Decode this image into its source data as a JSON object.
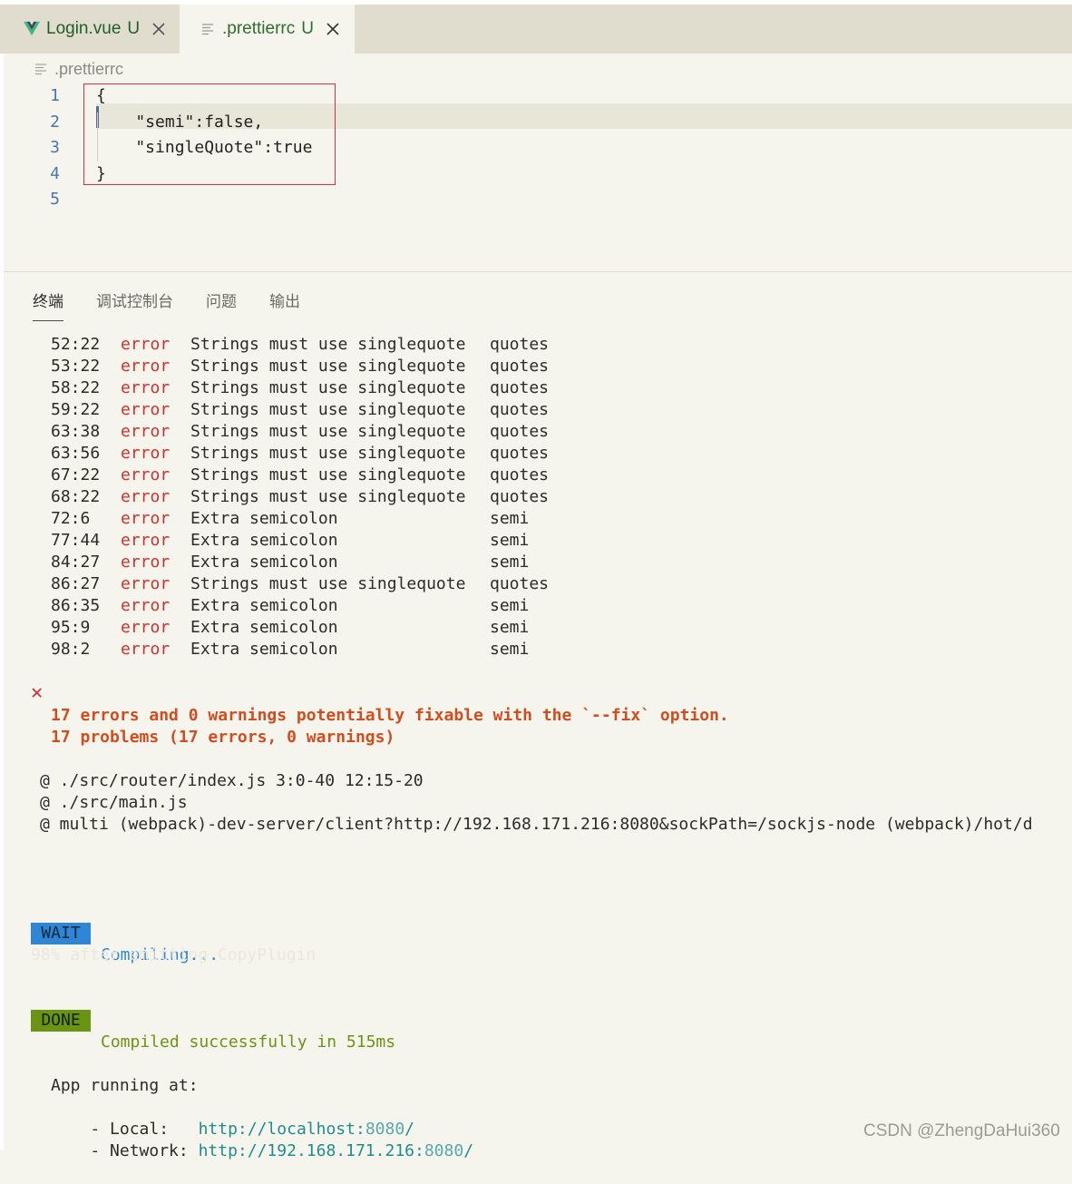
{
  "tabs": [
    {
      "label": "Login.vue",
      "status": "U",
      "icon": "vue-icon"
    },
    {
      "label": ".prettierrc",
      "status": "U",
      "icon": "file-lines-icon"
    }
  ],
  "breadcrumb": ".prettierrc",
  "editor": {
    "line_numbers": [
      "1",
      "2",
      "3",
      "4",
      "5"
    ],
    "lines": [
      "{",
      "    \"semi\":false,",
      "    \"singleQuote\":true",
      "}",
      ""
    ]
  },
  "panel_tabs": [
    "终端",
    "调试控制台",
    "问题",
    "输出"
  ],
  "terminal": {
    "lint_rows": [
      {
        "pos": "52:22",
        "level": "error",
        "msg": "Strings must use singlequote",
        "rule": "quotes"
      },
      {
        "pos": "53:22",
        "level": "error",
        "msg": "Strings must use singlequote",
        "rule": "quotes"
      },
      {
        "pos": "58:22",
        "level": "error",
        "msg": "Strings must use singlequote",
        "rule": "quotes"
      },
      {
        "pos": "59:22",
        "level": "error",
        "msg": "Strings must use singlequote",
        "rule": "quotes"
      },
      {
        "pos": "63:38",
        "level": "error",
        "msg": "Strings must use singlequote",
        "rule": "quotes"
      },
      {
        "pos": "63:56",
        "level": "error",
        "msg": "Strings must use singlequote",
        "rule": "quotes"
      },
      {
        "pos": "67:22",
        "level": "error",
        "msg": "Strings must use singlequote",
        "rule": "quotes"
      },
      {
        "pos": "68:22",
        "level": "error",
        "msg": "Strings must use singlequote",
        "rule": "quotes"
      },
      {
        "pos": "72:6",
        "level": "error",
        "msg": "Extra semicolon",
        "rule": "semi"
      },
      {
        "pos": "77:44",
        "level": "error",
        "msg": "Extra semicolon",
        "rule": "semi"
      },
      {
        "pos": "84:27",
        "level": "error",
        "msg": "Extra semicolon",
        "rule": "semi"
      },
      {
        "pos": "86:27",
        "level": "error",
        "msg": "Strings must use singlequote",
        "rule": "quotes"
      },
      {
        "pos": "86:35",
        "level": "error",
        "msg": "Extra semicolon",
        "rule": "semi"
      },
      {
        "pos": "95:9",
        "level": "error",
        "msg": "Extra semicolon",
        "rule": "semi"
      },
      {
        "pos": "98:2",
        "level": "error",
        "msg": "Extra semicolon",
        "rule": "semi"
      }
    ],
    "problems_summary": "17 problems (17 errors, 0 warnings)",
    "fixable_note": "17 errors and 0 warnings potentially fixable with the `--fix` option.",
    "trace_lines": [
      "@ ./src/router/index.js 3:0-40 12:15-20",
      "@ ./src/main.js",
      "@ multi (webpack)-dev-server/client?http://192.168.171.216:8080&sockPath=/sockjs-node (webpack)/hot/d"
    ],
    "wait_badge": "WAIT",
    "compiling_text": "Compiling...",
    "progress_text": "98% after emitting CopyPlugin",
    "done_badge": "DONE",
    "success_text": "Compiled successfully in 515ms",
    "app_running": "App running at:",
    "local_label": "- Local:   ",
    "local_url_base": "http://localhost:",
    "local_url_port": "8080",
    "local_url_tail": "/",
    "network_label": "- Network: ",
    "network_url_base": "http://192.168.171.216:",
    "network_url_port": "8080",
    "network_url_tail": "/"
  },
  "watermark": "CSDN @ZhengDaHui360",
  "colors": {
    "error": "#d32f2f",
    "problems": "#cf4d1f",
    "wait_badge": "#2e86d4",
    "done_badge": "#6b9414",
    "url": "#1f8c8f",
    "highlight_box": "#d8323c"
  }
}
